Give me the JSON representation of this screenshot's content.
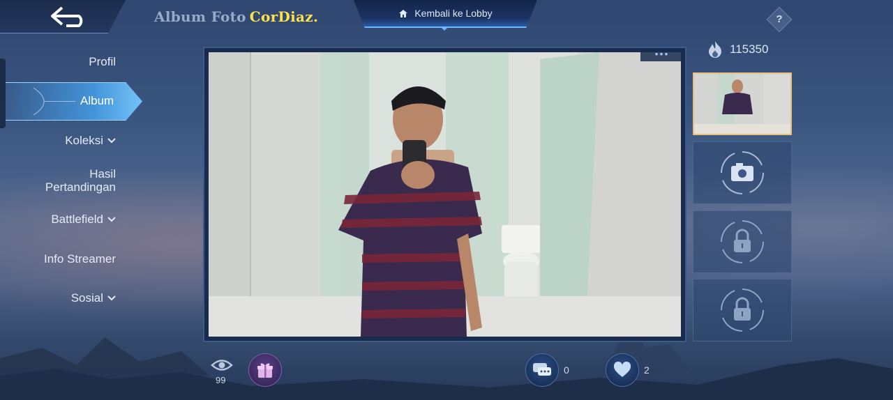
{
  "header": {
    "title_prefix": "Album Foto",
    "player_name": "CorDiaz.",
    "lobby_button": "Kembali ke Lobby",
    "help": "?"
  },
  "sidebar": {
    "items": [
      {
        "label": "Profil"
      },
      {
        "label": "Album"
      },
      {
        "label": "Koleksi"
      },
      {
        "label_line1": "Hasil",
        "label_line2": "Pertandingan"
      },
      {
        "label": "Battlefield"
      },
      {
        "label": "Info Streamer"
      },
      {
        "label": "Sosial"
      }
    ],
    "active": "Album"
  },
  "album": {
    "popularity": "115350",
    "photo_menu": "•••",
    "slots": [
      "photo",
      "camera",
      "locked",
      "locked"
    ]
  },
  "footer": {
    "views": "99",
    "comments": "0",
    "likes": "2"
  },
  "colors": {
    "player_name": "#ffe24a",
    "active_tab": "#46aaf8",
    "accent_border": "#6fb6ff"
  }
}
